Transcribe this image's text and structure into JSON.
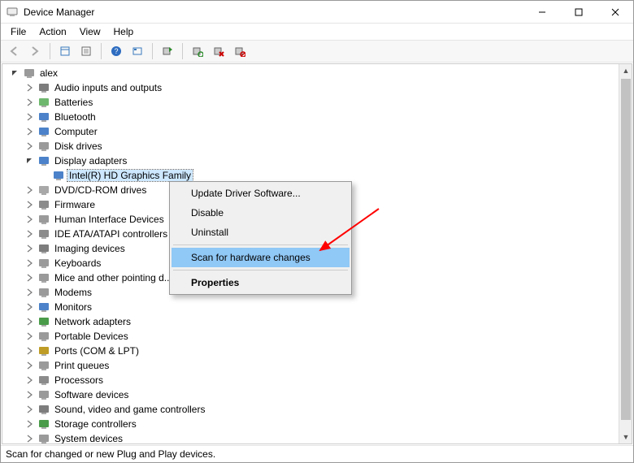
{
  "window": {
    "title": "Device Manager"
  },
  "menu": {
    "items": [
      "File",
      "Action",
      "View",
      "Help"
    ]
  },
  "toolbar": {
    "buttons": [
      {
        "name": "back-icon",
        "enabled": false
      },
      {
        "name": "forward-icon",
        "enabled": false
      },
      {
        "sep": true
      },
      {
        "name": "show-hidden-icon",
        "enabled": true
      },
      {
        "name": "properties-sheet-icon",
        "enabled": true
      },
      {
        "sep": true
      },
      {
        "name": "help-icon",
        "enabled": true
      },
      {
        "name": "action-icon",
        "enabled": true
      },
      {
        "sep": true
      },
      {
        "name": "update-driver-icon",
        "enabled": true
      },
      {
        "sep": true
      },
      {
        "name": "scan-hardware-icon",
        "enabled": true
      },
      {
        "name": "uninstall-icon",
        "enabled": true
      },
      {
        "name": "disable-device-icon",
        "enabled": true
      }
    ]
  },
  "tree": {
    "root": {
      "label": "alex",
      "icon": "computer-root-icon",
      "expanded": true
    },
    "nodes": [
      {
        "label": "Audio inputs and outputs",
        "icon": "audio-icon",
        "expanded": false
      },
      {
        "label": "Batteries",
        "icon": "battery-icon",
        "expanded": false
      },
      {
        "label": "Bluetooth",
        "icon": "bluetooth-icon",
        "expanded": false
      },
      {
        "label": "Computer",
        "icon": "computer-icon",
        "expanded": false
      },
      {
        "label": "Disk drives",
        "icon": "disk-icon",
        "expanded": false
      },
      {
        "label": "Display adapters",
        "icon": "display-icon",
        "expanded": true,
        "children": [
          {
            "label": "Intel(R) HD Graphics Family",
            "icon": "display-icon",
            "selected": true
          }
        ]
      },
      {
        "label": "DVD/CD-ROM drives",
        "icon": "cdrom-icon",
        "expanded": false
      },
      {
        "label": "Firmware",
        "icon": "firmware-icon",
        "expanded": false
      },
      {
        "label": "Human Interface Devices",
        "icon": "hid-icon",
        "expanded": false
      },
      {
        "label": "IDE ATA/ATAPI controllers",
        "icon": "ide-icon",
        "expanded": false
      },
      {
        "label": "Imaging devices",
        "icon": "imaging-icon",
        "expanded": false
      },
      {
        "label": "Keyboards",
        "icon": "keyboard-icon",
        "expanded": false
      },
      {
        "label": "Mice and other pointing devices",
        "icon": "mouse-icon",
        "expanded": false,
        "truncated_label": "Mice and other pointing d..."
      },
      {
        "label": "Modems",
        "icon": "modem-icon",
        "expanded": false
      },
      {
        "label": "Monitors",
        "icon": "monitor-icon",
        "expanded": false
      },
      {
        "label": "Network adapters",
        "icon": "network-icon",
        "expanded": false
      },
      {
        "label": "Portable Devices",
        "icon": "portable-icon",
        "expanded": false
      },
      {
        "label": "Ports (COM & LPT)",
        "icon": "ports-icon",
        "expanded": false
      },
      {
        "label": "Print queues",
        "icon": "print-icon",
        "expanded": false
      },
      {
        "label": "Processors",
        "icon": "cpu-icon",
        "expanded": false
      },
      {
        "label": "Software devices",
        "icon": "software-icon",
        "expanded": false
      },
      {
        "label": "Sound, video and game controllers",
        "icon": "sound-icon",
        "expanded": false
      },
      {
        "label": "Storage controllers",
        "icon": "storage-icon",
        "expanded": false
      },
      {
        "label": "System devices",
        "icon": "system-icon",
        "expanded": false,
        "clipped": true
      }
    ]
  },
  "context_menu": {
    "items": [
      {
        "label": "Update Driver Software...",
        "highlight": false
      },
      {
        "label": "Disable",
        "highlight": false
      },
      {
        "label": "Uninstall",
        "highlight": false
      },
      {
        "sep": true
      },
      {
        "label": "Scan for hardware changes",
        "highlight": true
      },
      {
        "sep": true
      },
      {
        "label": "Properties",
        "highlight": false,
        "bold": true
      }
    ]
  },
  "status": {
    "text": "Scan for changed or new Plug and Play devices."
  },
  "annotation": {
    "arrow_color": "#ff0000"
  }
}
